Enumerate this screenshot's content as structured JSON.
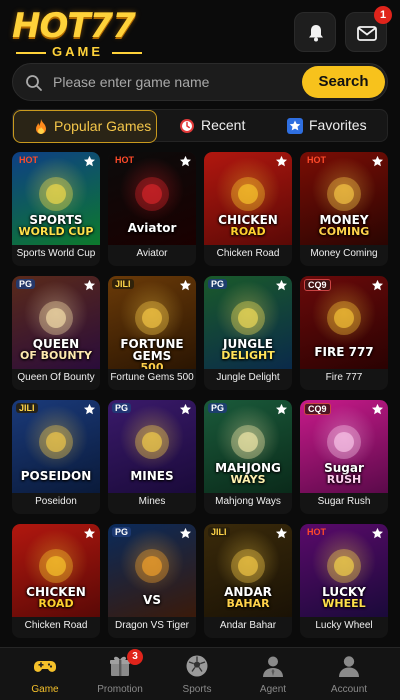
{
  "header": {
    "logo_main": "HOT77",
    "logo_sub": "GAME",
    "mail_badge": "1"
  },
  "search": {
    "placeholder": "Please enter game name",
    "button_label": "Search"
  },
  "tabs": [
    {
      "label": "Popular Games",
      "active": true
    },
    {
      "label": "Recent",
      "active": false
    },
    {
      "label": "Favorites",
      "active": false
    }
  ],
  "games": [
    {
      "name": "Sports World Cup",
      "tag": "HOT",
      "title": "SPORTS",
      "subtitle": "WORLD CUP"
    },
    {
      "name": "Aviator",
      "tag": "HOT",
      "title": "Aviator",
      "subtitle": ""
    },
    {
      "name": "Chicken Road",
      "tag": "",
      "title": "CHICKEN",
      "subtitle": "ROAD"
    },
    {
      "name": "Money Coming",
      "tag": "HOT",
      "title": "MONEY",
      "subtitle": "COMING"
    },
    {
      "name": "Queen Of Bounty",
      "tag": "PG",
      "title": "QUEEN",
      "subtitle": "OF BOUNTY"
    },
    {
      "name": "Fortune Gems 500",
      "tag": "JILI",
      "title": "FORTUNE GEMS",
      "subtitle": "500"
    },
    {
      "name": "Jungle Delight",
      "tag": "PG",
      "title": "JUNGLE",
      "subtitle": "DELIGHT"
    },
    {
      "name": "Fire 777",
      "tag": "CQ9",
      "title": "FIRE 777",
      "subtitle": ""
    },
    {
      "name": "Poseidon",
      "tag": "JILI",
      "title": "POSEIDON",
      "subtitle": ""
    },
    {
      "name": "Mines",
      "tag": "PG",
      "title": "MINES",
      "subtitle": ""
    },
    {
      "name": "Mahjong Ways",
      "tag": "PG",
      "title": "MAHJONG",
      "subtitle": "WAYS"
    },
    {
      "name": "Sugar Rush",
      "tag": "CQ9",
      "title": "Sugar",
      "subtitle": "RUSH"
    },
    {
      "name": "Chicken Road",
      "tag": "",
      "title": "CHICKEN",
      "subtitle": "ROAD"
    },
    {
      "name": "Dragon VS Tiger",
      "tag": "PG",
      "title": "VS",
      "subtitle": ""
    },
    {
      "name": "Andar Bahar",
      "tag": "JILI",
      "title": "ANDAR",
      "subtitle": "BAHAR"
    },
    {
      "name": "Lucky Wheel",
      "tag": "HOT",
      "title": "LUCKY",
      "subtitle": "WHEEL"
    }
  ],
  "nav": [
    {
      "label": "Game",
      "active": true,
      "icon": "gamepad-icon"
    },
    {
      "label": "Promotion",
      "active": false,
      "icon": "gift-icon",
      "badge": "3"
    },
    {
      "label": "Sports",
      "active": false,
      "icon": "soccer-ball-icon"
    },
    {
      "label": "Agent",
      "active": false,
      "icon": "agent-icon"
    },
    {
      "label": "Account",
      "active": false,
      "icon": "account-icon"
    }
  ],
  "colors": {
    "accent": "#f7c21c",
    "badge": "#e0241b",
    "background": "#0b0b0b"
  }
}
